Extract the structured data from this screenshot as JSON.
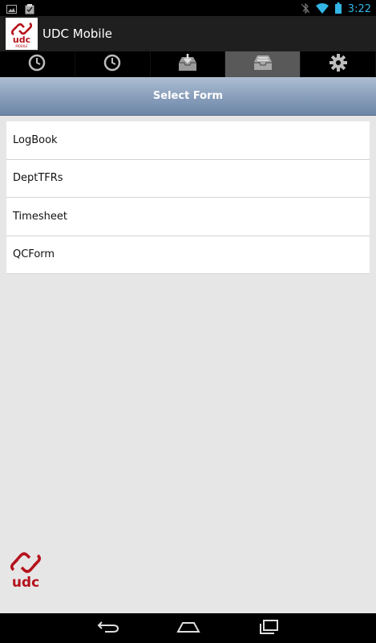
{
  "status_bar": {
    "time": "3:22",
    "icons": [
      "image-icon",
      "clipboard-check-icon",
      "bluetooth-off-icon",
      "wifi-icon",
      "battery-icon"
    ]
  },
  "action_bar": {
    "title": "UDC Mobile",
    "logo_text": "udc",
    "logo_subtext": "MOBILE"
  },
  "tabs": [
    {
      "icon": "clock-icon",
      "active": false
    },
    {
      "icon": "clock-icon",
      "active": false
    },
    {
      "icon": "inbox-download-icon",
      "active": false
    },
    {
      "icon": "inbox-icon",
      "active": true
    },
    {
      "icon": "gear-icon",
      "active": false
    }
  ],
  "header": {
    "title": "Select Form"
  },
  "forms": [
    {
      "label": "LogBook"
    },
    {
      "label": "DeptTFRs"
    },
    {
      "label": "Timesheet"
    },
    {
      "label": "QCForm"
    }
  ],
  "footer": {
    "logo_text": "udc"
  },
  "nav_bar": {
    "buttons": [
      "back-icon",
      "home-icon",
      "recents-icon"
    ]
  },
  "colors": {
    "accent": "#33b5e5",
    "brand_red": "#b5121b",
    "header_gradient_top": "#aebed3",
    "header_gradient_bottom": "#6d86a7"
  }
}
